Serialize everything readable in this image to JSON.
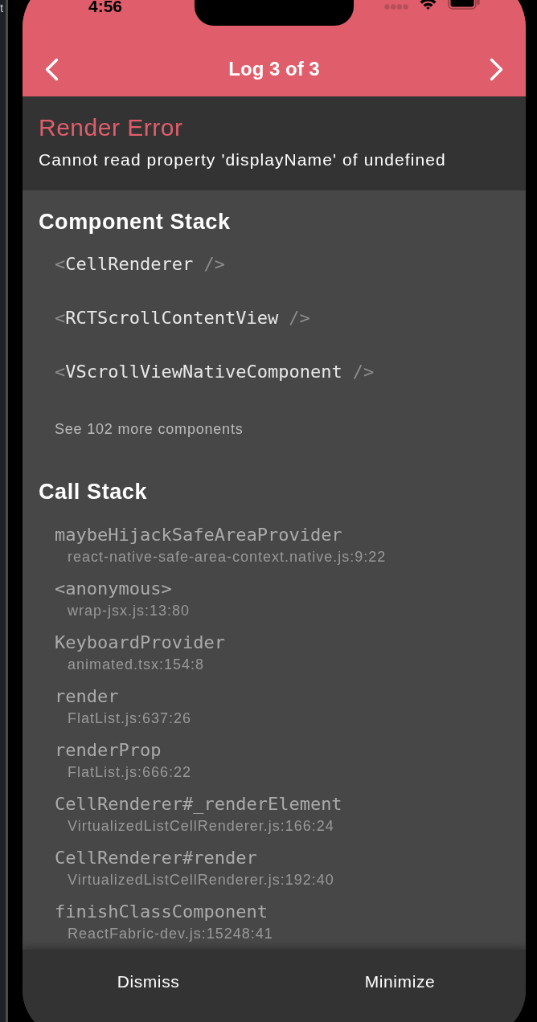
{
  "background_editor": {
    "text": "t"
  },
  "status_bar": {
    "time": "4:56"
  },
  "header": {
    "title": "Log 3 of 3"
  },
  "error": {
    "title": "Render Error",
    "message": "Cannot read property 'displayName' of undefined"
  },
  "component_stack": {
    "title": "Component Stack",
    "items": [
      {
        "open": "<",
        "name": "CellRenderer",
        "close": "/>"
      },
      {
        "open": "<",
        "name": "RCTScrollContentView",
        "close": "/>"
      },
      {
        "open": "<",
        "name": "VScrollViewNativeComponent",
        "close": "/>"
      }
    ],
    "more": "See 102 more components"
  },
  "call_stack": {
    "title": "Call Stack",
    "frames": [
      {
        "method": "maybeHijackSafeAreaProvider",
        "location": "react-native-safe-area-context.native.js:9:22"
      },
      {
        "method": "<anonymous>",
        "location": "wrap-jsx.js:13:80"
      },
      {
        "method": "KeyboardProvider",
        "location": "animated.tsx:154:8"
      },
      {
        "method": "render",
        "location": "FlatList.js:637:26"
      },
      {
        "method": "renderProp",
        "location": "FlatList.js:666:22"
      },
      {
        "method": "CellRenderer#_renderElement",
        "location": "VirtualizedListCellRenderer.js:166:24"
      },
      {
        "method": "CellRenderer#render",
        "location": "VirtualizedListCellRenderer.js:192:40"
      },
      {
        "method": "finishClassComponent",
        "location": "ReactFabric-dev.js:15248:41"
      }
    ]
  },
  "footer": {
    "buttons": [
      "Dismiss",
      "Minimize"
    ]
  }
}
